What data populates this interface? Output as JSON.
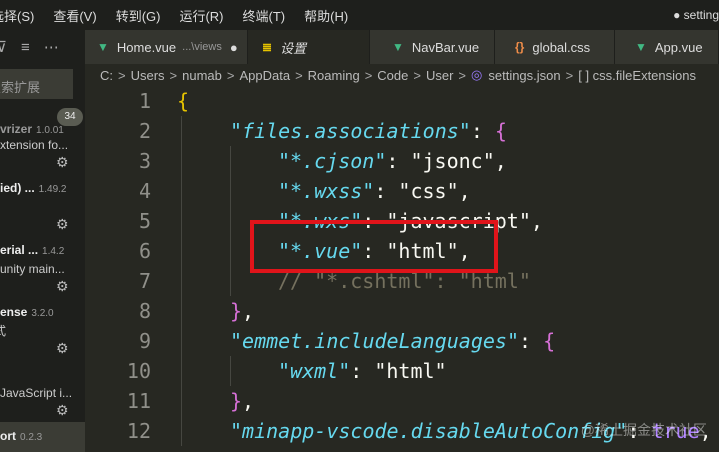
{
  "menubar": {
    "items": [
      "选择(S)",
      "查看(V)",
      "转到(G)",
      "运行(R)",
      "终端(T)",
      "帮助(H)"
    ],
    "title": "● setting"
  },
  "sidebar": {
    "search_placeholder": "搜索扩展",
    "badge": "34",
    "extensions": [
      {
        "name": "vrizer",
        "version": "1.0.01",
        "desc": "xtension fo..."
      },
      {
        "name": "ied) ...",
        "version": "1.49.2",
        "desc": ""
      },
      {
        "name": "erial ...",
        "version": "1.4.2",
        "desc": "unity main..."
      },
      {
        "name": "ense",
        "version": "3.2.0",
        "desc": "式"
      },
      {
        "name": "",
        "version": "",
        "desc": "JavaScript i..."
      },
      {
        "name": "ort",
        "version": "0.2.3",
        "desc": ""
      }
    ]
  },
  "tabs": [
    {
      "label": "Home.vue",
      "detail": "...\\views",
      "icon": "vue-icon",
      "modified": true
    },
    {
      "label": "设置",
      "icon": "settings-icon"
    },
    {
      "label": "NavBar.vue",
      "icon": "vue-icon"
    },
    {
      "label": "global.css",
      "icon": "css-icon"
    },
    {
      "label": "App.vue",
      "icon": "vue-icon"
    }
  ],
  "breadcrumb": [
    "C:",
    "Users",
    "numab",
    "AppData",
    "Roaming",
    "Code",
    "User",
    "settings.json",
    "[ ] css.fileExtensions"
  ],
  "code": {
    "l1": "{",
    "l2k": "\"files.associations\"",
    "l2r": ": ",
    "l2b": "{",
    "l3k": "\"*.cjson\"",
    "l3r": ": \"jsonc\",",
    "l4k": "\"*.wxss\"",
    "l4r": ": \"css\",",
    "l5k": "\"*.wxs\"",
    "l5r": ": \"javascript\",",
    "l6k": "\"*.vue\"",
    "l6r": ": \"html\",",
    "l7": "// \"*.cshtml\": \"html\"",
    "l8b": "}",
    "l8r": ",",
    "l9k": "\"emmet.includeLanguages\"",
    "l9r": ": ",
    "l9b": "{",
    "l10k": "\"wxml\"",
    "l10r": ": \"html\"",
    "l11b": "}",
    "l11r": ",",
    "l12k": "\"minapp-vscode.disableAutoConfig\"",
    "l12r": ": ",
    "l12t": "true",
    "l12c": ","
  },
  "line_numbers": [
    "1",
    "2",
    "3",
    "4",
    "5",
    "6",
    "7",
    "8",
    "9",
    "10",
    "11",
    "12"
  ],
  "watermark": "@稀土掘金技术社区"
}
